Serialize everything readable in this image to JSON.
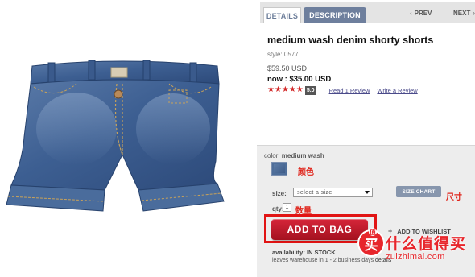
{
  "tabs": {
    "details": "DETAILS",
    "description": "DESCRIPTION",
    "prev": "PREV",
    "next": "NEXT"
  },
  "product": {
    "title": "medium wash denim shorty shorts",
    "style": "style: 0577",
    "old_price": "$59.50 USD",
    "now_price": "now : $35.00 USD",
    "rating": 5,
    "rating_stars": "★★★★★",
    "rating_badge": "5.0",
    "read_reviews": "Read 1 Review",
    "write_review": "Write a Review",
    "image_icon": "denim-shorts-icon"
  },
  "options": {
    "color_label": "color:",
    "color_value": "medium wash",
    "size_label": "size:",
    "size_placeholder": "select a size",
    "size_chart": "SIZE CHART",
    "qty_label": "qty:",
    "qty_value": "1",
    "add_to_bag": "ADD TO BAG",
    "wishlist": "ADD TO WISHLIST",
    "availability_label": "availability:",
    "availability_value": "IN STOCK",
    "leaves": "leaves warehouse in 1 - 2 business days",
    "details_link": "details"
  },
  "annotations": {
    "color": "颜色",
    "size": "尺寸",
    "qty": "数量"
  },
  "watermark": {
    "logo_char": "买",
    "badge": "值",
    "cn": "什么值得买",
    "en": "zuizhimai.com"
  },
  "colors": {
    "accent_red": "#d32a2a",
    "tab_blue": "#6e7f9d",
    "swatch": "#4e6e9a"
  }
}
